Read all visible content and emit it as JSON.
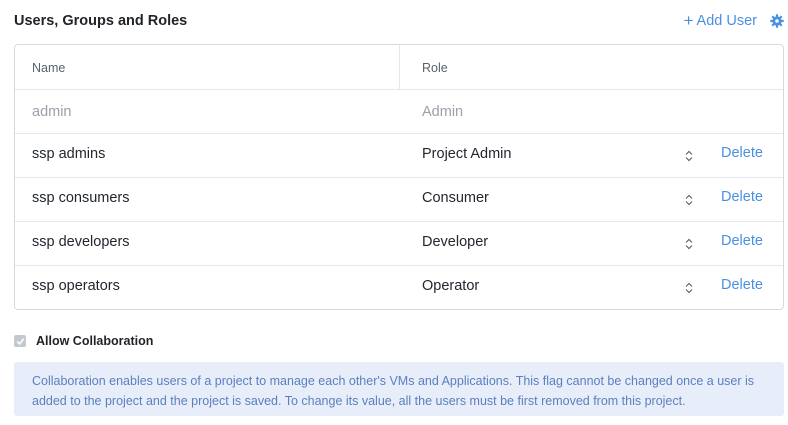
{
  "header": {
    "title": "Users, Groups and Roles",
    "add_user_label": "Add User",
    "add_icon": "plus-icon",
    "settings_icon": "gear-icon"
  },
  "table": {
    "columns": {
      "name": "Name",
      "role": "Role"
    },
    "rows": [
      {
        "name": "admin",
        "role": "Admin",
        "disabled": true
      },
      {
        "name": "ssp admins",
        "role": "Project Admin",
        "delete_label": "Delete"
      },
      {
        "name": "ssp consumers",
        "role": "Consumer",
        "delete_label": "Delete"
      },
      {
        "name": "ssp developers",
        "role": "Developer",
        "delete_label": "Delete"
      },
      {
        "name": "ssp operators",
        "role": "Operator",
        "delete_label": "Delete"
      }
    ]
  },
  "collaboration": {
    "label": "Allow Collaboration",
    "checked": true,
    "disabled": true,
    "info": "Collaboration enables users of a project to manage each other's VMs and Applications. This flag cannot be changed once a user is added to the project and the project is saved. To change its value, all the users must be first removed from this project."
  },
  "colors": {
    "accent": "#4a90e2",
    "info_bg": "#e8eef9",
    "info_text": "#5a7fc0",
    "border": "#d6dae0"
  }
}
